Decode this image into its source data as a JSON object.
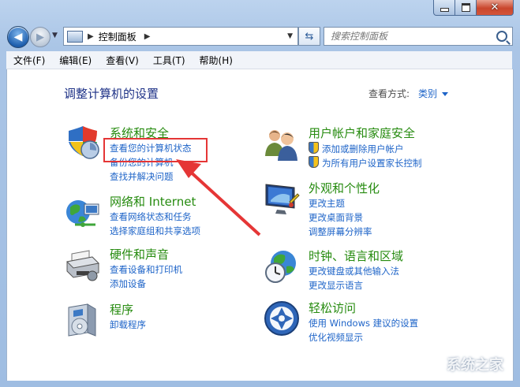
{
  "window": {
    "caption_min_icon": "minimize-icon",
    "caption_max_icon": "maximize-icon",
    "caption_close_icon": "close-icon"
  },
  "navigation": {
    "breadcrumb": "控制面板",
    "search_placeholder": "搜索控制面板"
  },
  "menu": [
    "文件(F)",
    "编辑(E)",
    "查看(V)",
    "工具(T)",
    "帮助(H)"
  ],
  "main": {
    "heading": "调整计算机的设置",
    "view_by_label": "查看方式:",
    "view_by_value": "类别"
  },
  "categories": [
    {
      "title": "系统和安全",
      "icon": "shield-icon",
      "links": [
        "查看您的计算机状态",
        "备份您的计算机",
        "查找并解决问题"
      ]
    },
    {
      "title": "网络和 Internet",
      "icon": "globe-network-icon",
      "links": [
        "查看网络状态和任务",
        "选择家庭组和共享选项"
      ]
    },
    {
      "title": "硬件和声音",
      "icon": "printer-icon",
      "links": [
        "查看设备和打印机",
        "添加设备"
      ]
    },
    {
      "title": "程序",
      "icon": "programs-icon",
      "links": [
        "卸载程序"
      ]
    },
    {
      "title": "用户帐户和家庭安全",
      "icon": "users-icon",
      "links": [
        "添加或删除用户帐户",
        "为所有用户设置家长控制"
      ]
    },
    {
      "title": "外观和个性化",
      "icon": "monitor-icon",
      "links": [
        "更改主题",
        "更改桌面背景",
        "调整屏幕分辨率"
      ]
    },
    {
      "title": "时钟、语言和区域",
      "icon": "clock-globe-icon",
      "links": [
        "更改键盘或其他输入法",
        "更改显示语言"
      ]
    },
    {
      "title": "轻松访问",
      "icon": "accessibility-icon",
      "links": [
        "使用 Windows 建议的设置",
        "优化视频显示"
      ]
    }
  ],
  "watermark": "系统之家",
  "colors": {
    "heading": "#1e3287",
    "category": "#268b0f",
    "link": "#1e64c8",
    "highlight": "#e53636"
  }
}
